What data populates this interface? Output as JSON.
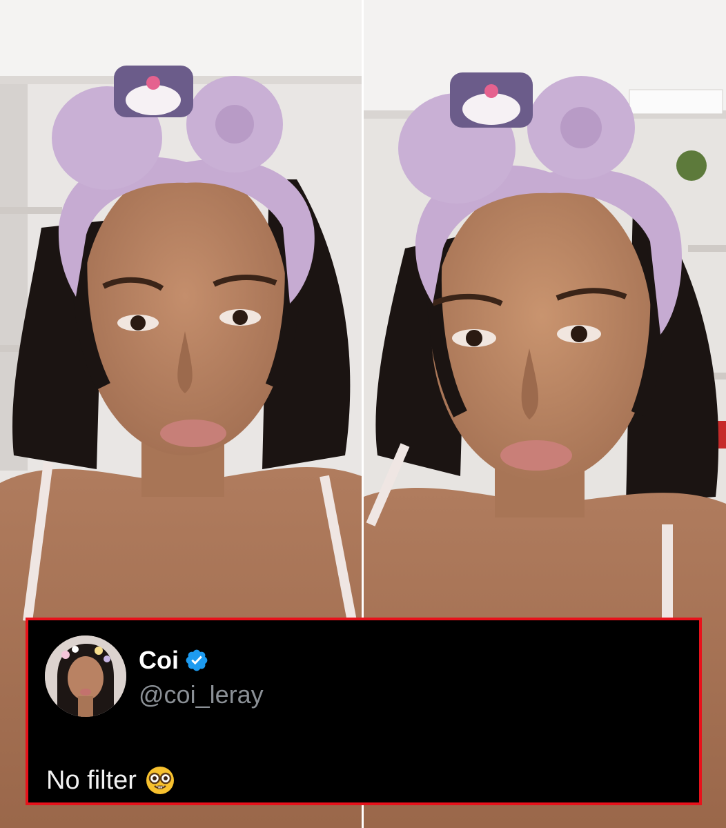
{
  "tweet": {
    "display_name": "Coi",
    "handle": "@coi_leray",
    "text": "No filter",
    "emoji": "nerd-face-emoji",
    "verified": true
  },
  "colors": {
    "card_background": "#000000",
    "card_border": "#e8121b",
    "name": "#ffffff",
    "handle": "#8b9096",
    "verified_badge": "#1d9bf0"
  }
}
